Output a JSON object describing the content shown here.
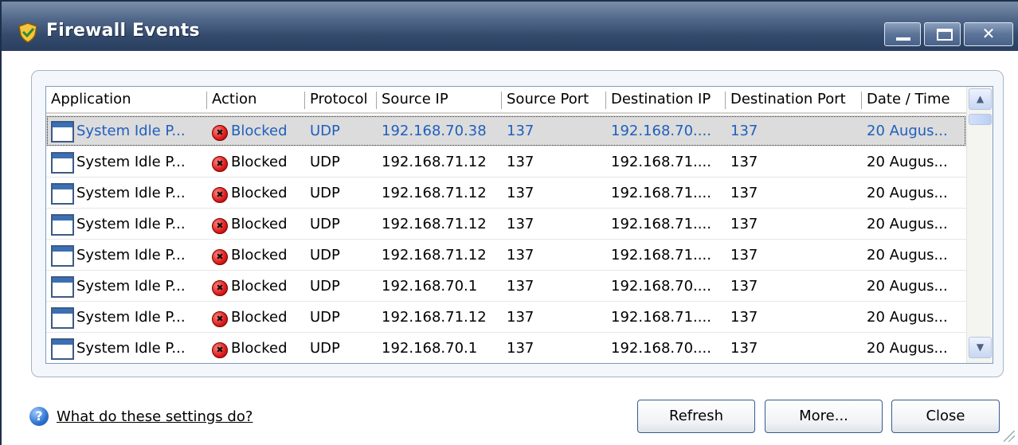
{
  "window": {
    "title": "Firewall Events",
    "icon": "shield-icon",
    "controls": [
      "minimize-icon",
      "maximize-icon",
      "close-icon"
    ]
  },
  "table": {
    "columns": [
      "Application",
      "Action",
      "Protocol",
      "Source IP",
      "Source Port",
      "Destination IP",
      "Destination Port",
      "Date / Time"
    ],
    "rows": [
      {
        "application": "System Idle P...",
        "action": "Blocked",
        "protocol": "UDP",
        "source_ip": "192.168.70.38",
        "source_port": "137",
        "destination_ip": "192.168.70....",
        "destination_port": "137",
        "datetime": "20 Augus...",
        "selected": true
      },
      {
        "application": "System Idle P...",
        "action": "Blocked",
        "protocol": "UDP",
        "source_ip": "192.168.71.12",
        "source_port": "137",
        "destination_ip": "192.168.71....",
        "destination_port": "137",
        "datetime": "20 Augus..."
      },
      {
        "application": "System Idle P...",
        "action": "Blocked",
        "protocol": "UDP",
        "source_ip": "192.168.71.12",
        "source_port": "137",
        "destination_ip": "192.168.71....",
        "destination_port": "137",
        "datetime": "20 Augus..."
      },
      {
        "application": "System Idle P...",
        "action": "Blocked",
        "protocol": "UDP",
        "source_ip": "192.168.71.12",
        "source_port": "137",
        "destination_ip": "192.168.71....",
        "destination_port": "137",
        "datetime": "20 Augus..."
      },
      {
        "application": "System Idle P...",
        "action": "Blocked",
        "protocol": "UDP",
        "source_ip": "192.168.71.12",
        "source_port": "137",
        "destination_ip": "192.168.71....",
        "destination_port": "137",
        "datetime": "20 Augus..."
      },
      {
        "application": "System Idle P...",
        "action": "Blocked",
        "protocol": "UDP",
        "source_ip": "192.168.70.1",
        "source_port": "137",
        "destination_ip": "192.168.70....",
        "destination_port": "137",
        "datetime": "20 Augus..."
      },
      {
        "application": "System Idle P...",
        "action": "Blocked",
        "protocol": "UDP",
        "source_ip": "192.168.71.12",
        "source_port": "137",
        "destination_ip": "192.168.71....",
        "destination_port": "137",
        "datetime": "20 Augus..."
      },
      {
        "application": "System Idle P...",
        "action": "Blocked",
        "protocol": "UDP",
        "source_ip": "192.168.70.1",
        "source_port": "137",
        "destination_ip": "192.168.70....",
        "destination_port": "137",
        "datetime": "20 Augus..."
      }
    ]
  },
  "footer": {
    "help_link": "What do these settings do?",
    "refresh_label": "Refresh",
    "more_label": "More...",
    "close_label": "Close"
  },
  "colors": {
    "titlebar": "#334a6c",
    "selected_text": "#1f5fbf",
    "blocked_icon": "#e02020"
  }
}
